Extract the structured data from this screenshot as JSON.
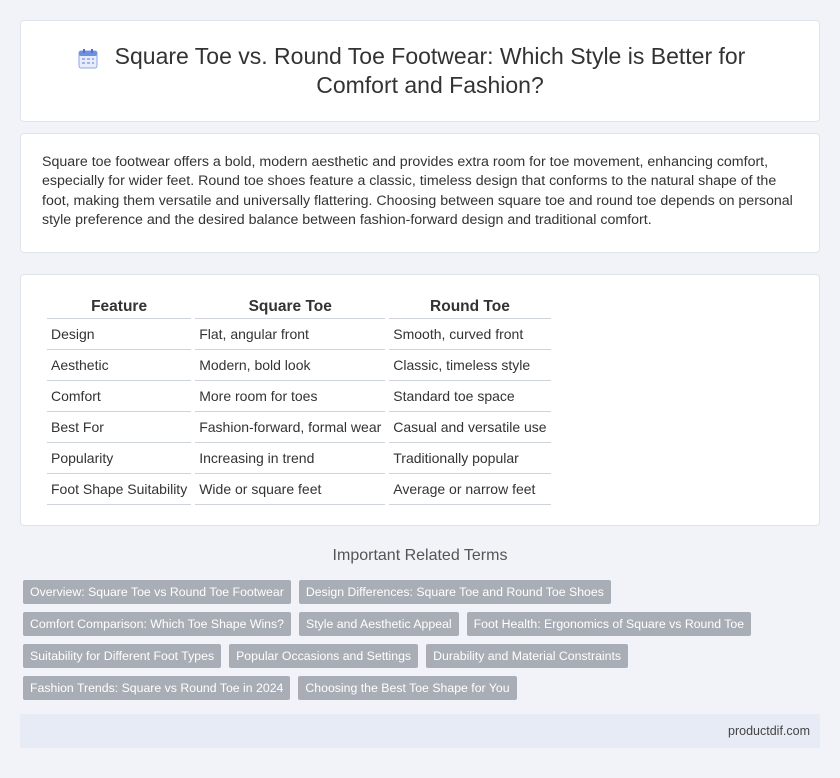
{
  "header": {
    "title": "Square Toe vs. Round Toe Footwear: Which Style is Better for Comfort and Fashion?",
    "icon": "calendar-icon"
  },
  "summary": {
    "text": "Square toe footwear offers a bold, modern aesthetic and provides extra room for toe movement, enhancing comfort, especially for wider feet. Round toe shoes feature a classic, timeless design that conforms to the natural shape of the foot, making them versatile and universally flattering. Choosing between square toe and round toe depends on personal style preference and the desired balance between fashion-forward design and traditional comfort."
  },
  "table": {
    "headers": [
      "Feature",
      "Square Toe",
      "Round Toe"
    ],
    "rows": [
      [
        "Design",
        "Flat, angular front",
        "Smooth, curved front"
      ],
      [
        "Aesthetic",
        "Modern, bold look",
        "Classic, timeless style"
      ],
      [
        "Comfort",
        "More room for toes",
        "Standard toe space"
      ],
      [
        "Best For",
        "Fashion-forward, formal wear",
        "Casual and versatile use"
      ],
      [
        "Popularity",
        "Increasing in trend",
        "Traditionally popular"
      ],
      [
        "Foot Shape Suitability",
        "Wide or square feet",
        "Average or narrow feet"
      ]
    ]
  },
  "related": {
    "title": "Important Related Terms",
    "tags": [
      "Overview: Square Toe vs Round Toe Footwear",
      "Design Differences: Square Toe and Round Toe Shoes",
      "Comfort Comparison: Which Toe Shape Wins?",
      "Style and Aesthetic Appeal",
      "Foot Health: Ergonomics of Square vs Round Toe",
      "Suitability for Different Foot Types",
      "Popular Occasions and Settings",
      "Durability and Material Constraints",
      "Fashion Trends: Square vs Round Toe in 2024",
      "Choosing the Best Toe Shape for You"
    ]
  },
  "footer": {
    "site": "productdif.com"
  },
  "colors": {
    "background": "#f1f3f8",
    "card": "#ffffff",
    "tag": "#a8adb6",
    "footer": "#e6ebf5",
    "icon_accent": "#6f8fe0"
  }
}
